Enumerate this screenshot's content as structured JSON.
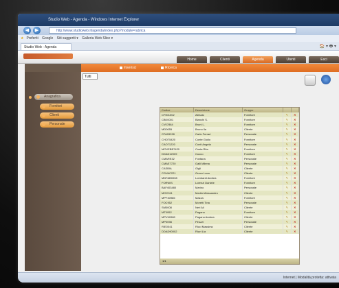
{
  "window": {
    "title": "Studio Web - Agenda - Windows Internet Explorer"
  },
  "address": {
    "url": "http://www.studioweb.it/agenda/index.php?module=rubrica"
  },
  "favorites": {
    "label": "Preferiti",
    "items": [
      "Google",
      "Siti suggeriti ▾",
      "Galleria Web Slice ▾"
    ]
  },
  "browser_tab": {
    "label": "Studio Web - Agenda"
  },
  "browser_tools": "🏠 ▾ 🖶 ▾",
  "app": {
    "nav_tabs": [
      "Home",
      "Clienti",
      "Agenda",
      "Utenti",
      "Esci"
    ],
    "active_nav": 2
  },
  "sidebar": {
    "main_item": "Anagrafica",
    "sub_items": [
      "Fornitori",
      "Clienti",
      "Personale"
    ]
  },
  "subheader": {
    "items": [
      "Inserisci",
      "Ricerca"
    ]
  },
  "filter": {
    "selected": "Tutti"
  },
  "table": {
    "columns": [
      "Codice",
      "Descrizione",
      "Gruppo",
      "",
      ""
    ],
    "rows": [
      [
        "CF001002",
        "Alessio",
        "Fornitore"
      ],
      [
        "CBK0001",
        "Bianchi S.",
        "Fornitore"
      ],
      [
        "CV07884",
        "Bruni L.",
        "Fornitore"
      ],
      [
        "MD0055",
        "Bruno Ila",
        "Cliente"
      ],
      [
        "CFA09228",
        "Carlo Ferrari",
        "Personale"
      ],
      [
        "CHO75420",
        "Conte Giulio",
        "Fornitore"
      ],
      [
        "CAO71220",
        "Conti Angela",
        "Personale"
      ],
      [
        "MOVEBB7420",
        "Costa Rita",
        "Fornitore"
      ],
      [
        "DDAD12009",
        "Cuoco",
        "Fornitore"
      ],
      [
        "CMARE32",
        "Fontana",
        "Personale"
      ],
      [
        "CMAE7720",
        "Galli Milena",
        "Personale"
      ],
      [
        "CASBIA",
        "Gigli",
        "Cliente"
      ],
      [
        "CGVAC221",
        "Greco Luca",
        "Cliente"
      ],
      [
        "MDFAB0008",
        "Lombardi Andrea",
        "Fornitore"
      ],
      [
        "FORWIS",
        "Lorenzi Daniele",
        "Fornitore"
      ],
      [
        "BAF403480",
        "Marino",
        "Personale"
      ],
      [
        "MOC011",
        "Martini Alessandro",
        "Cliente"
      ],
      [
        "MPF40985",
        "Mazza",
        "Fornitore"
      ],
      [
        "FOC952",
        "Moretti Tina",
        "Personale"
      ],
      [
        "SM0008",
        "Neri Ali",
        "Cliente"
      ],
      [
        "MT0952",
        "Pagano",
        "Fornitore"
      ],
      [
        "MPV40980",
        "Pagano Andrea",
        "Cliente"
      ],
      [
        "MP0098",
        "Pirozzi",
        "Personale"
      ],
      [
        "RIE0041",
        "Ricci Massimo",
        "Cliente"
      ],
      [
        "DDAD90002",
        "Rizzi Lia",
        "Cliente"
      ]
    ],
    "footer": "1/1"
  },
  "statusbar": {
    "right": "Internet | Modalità protetta: attivata"
  }
}
